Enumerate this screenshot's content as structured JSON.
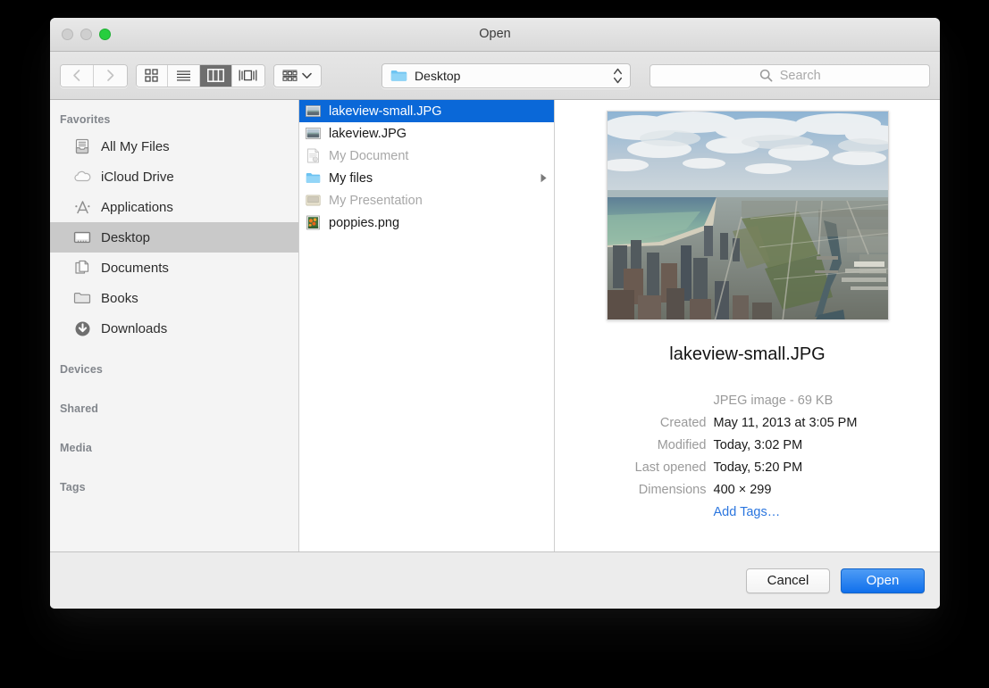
{
  "window": {
    "title": "Open",
    "traffic_lights": [
      "close-button",
      "minimize-button",
      "zoom-button"
    ]
  },
  "toolbar": {
    "back_icon": "chevron-left-icon",
    "forward_icon": "chevron-right-icon",
    "view_modes": [
      {
        "name": "icon-view",
        "icon": "grid-icon",
        "active": false
      },
      {
        "name": "list-view",
        "icon": "list-icon",
        "active": false
      },
      {
        "name": "column-view",
        "icon": "columns-icon",
        "active": true
      },
      {
        "name": "coverflow-view",
        "icon": "coverflow-icon",
        "active": false
      }
    ],
    "arrange": {
      "icon": "arrange-icon",
      "chevron": "chevron-down-icon"
    },
    "path_popup": {
      "label": "Desktop",
      "icon": "blue-folder-icon",
      "stepper": "up-down-stepper-icon"
    },
    "search": {
      "placeholder": "Search",
      "icon": "search-icon"
    }
  },
  "sidebar": {
    "sections": [
      {
        "header": "Favorites",
        "items": [
          {
            "label": "All My Files",
            "icon": "all-my-files-icon"
          },
          {
            "label": "iCloud Drive",
            "icon": "cloud-icon"
          },
          {
            "label": "Applications",
            "icon": "applications-icon"
          },
          {
            "label": "Desktop",
            "icon": "desktop-icon",
            "selected": true
          },
          {
            "label": "Documents",
            "icon": "documents-icon"
          },
          {
            "label": "Books",
            "icon": "folder-icon"
          },
          {
            "label": "Downloads",
            "icon": "downloads-icon"
          }
        ]
      },
      {
        "header": "Devices",
        "items": []
      },
      {
        "header": "Shared",
        "items": []
      },
      {
        "header": "Media",
        "items": []
      },
      {
        "header": "Tags",
        "items": []
      }
    ]
  },
  "file_list": {
    "items": [
      {
        "name": "lakeview-small.JPG",
        "icon": "image-thumbnail-icon",
        "selected": true,
        "disabled": false,
        "has_children": false
      },
      {
        "name": "lakeview.JPG",
        "icon": "image-thumbnail-icon",
        "selected": false,
        "disabled": false,
        "has_children": false
      },
      {
        "name": "My Document",
        "icon": "document-icon",
        "selected": false,
        "disabled": true,
        "has_children": false
      },
      {
        "name": "My files",
        "icon": "blue-folder-icon",
        "selected": false,
        "disabled": false,
        "has_children": true
      },
      {
        "name": "My Presentation",
        "icon": "presentation-icon",
        "selected": false,
        "disabled": true,
        "has_children": false
      },
      {
        "name": "poppies.png",
        "icon": "poppies-thumbnail-icon",
        "selected": false,
        "disabled": false,
        "has_children": false
      }
    ]
  },
  "preview": {
    "image_alt": "Aerial photograph of Chicago skyline with Lake Michigan",
    "filename": "lakeview-small.JPG",
    "kind_and_size": "JPEG image - 69 KB",
    "fields": [
      {
        "key": "Created",
        "value": "May 11, 2013 at 3:05 PM"
      },
      {
        "key": "Modified",
        "value": "Today, 3:02 PM"
      },
      {
        "key": "Last opened",
        "value": "Today, 5:20 PM"
      },
      {
        "key": "Dimensions",
        "value": "400 × 299"
      }
    ],
    "add_tags_label": "Add Tags…"
  },
  "footer": {
    "cancel_label": "Cancel",
    "open_label": "Open"
  },
  "colors": {
    "selection_blue": "#0a68d8",
    "primary_button": "#1070ec",
    "link_blue": "#2b76df",
    "sidebar_selected": "#c9c9c9",
    "zoom_green": "#27ce3e"
  }
}
